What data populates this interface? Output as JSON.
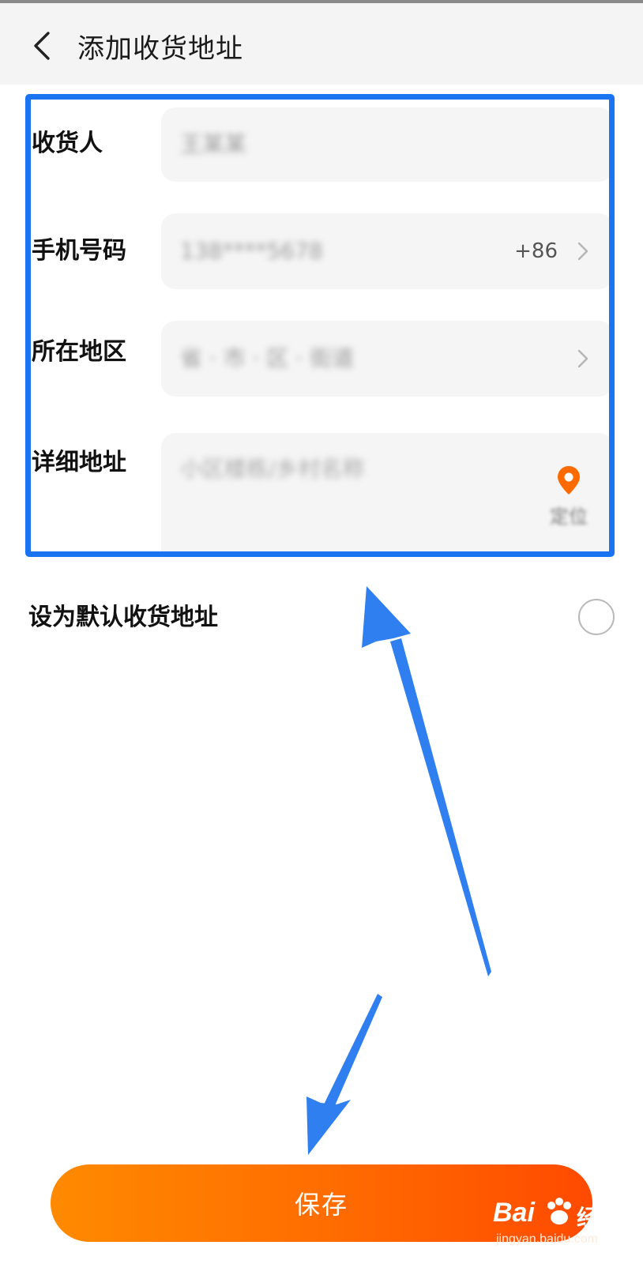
{
  "header": {
    "title": "添加收货地址"
  },
  "form": {
    "receiver": {
      "label": "收货人",
      "value": "王某某"
    },
    "phone": {
      "label": "手机号码",
      "value": "138****5678",
      "country_code": "+86"
    },
    "region": {
      "label": "所在地区",
      "value": "省 · 市 · 区 · 街道"
    },
    "detail": {
      "label": "详细地址",
      "placeholder": "小区楼栋/乡村名称",
      "locate_label": "定位"
    }
  },
  "default_address": {
    "label": "设为默认收货地址",
    "checked": false
  },
  "save_button": {
    "label": "保存"
  },
  "watermark": {
    "brand": "Bai",
    "brand_suffix": "经验",
    "url": "jingyan.baidu.com"
  },
  "colors": {
    "accent": "#ff6a00",
    "annotation": "#1a73f0",
    "field_bg": "#f5f5f5",
    "header_bg": "#f4f4f4"
  },
  "icons": {
    "back": "chevron-left-icon",
    "chevron": "chevron-right-icon",
    "locate": "location-pin-icon"
  }
}
